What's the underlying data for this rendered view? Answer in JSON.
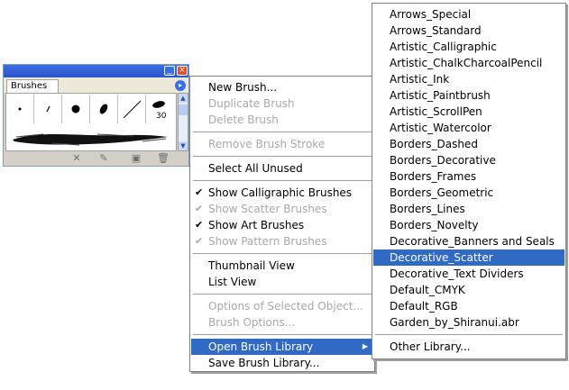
{
  "palette": {
    "tab_label": "Brushes",
    "first_brush_size": "30"
  },
  "menu": {
    "items": [
      {
        "label": "New Brush...",
        "enabled": true
      },
      {
        "label": "Duplicate Brush",
        "enabled": false
      },
      {
        "label": "Delete Brush",
        "enabled": false
      },
      {
        "label": "Remove Brush Stroke",
        "enabled": false
      },
      {
        "label": "Select All Unused",
        "enabled": true
      },
      {
        "label": "Show Calligraphic Brushes",
        "enabled": true,
        "checked": true
      },
      {
        "label": "Show Scatter Brushes",
        "enabled": false,
        "checked": true
      },
      {
        "label": "Show Art Brushes",
        "enabled": true,
        "checked": true
      },
      {
        "label": "Show Pattern Brushes",
        "enabled": false,
        "checked": true
      },
      {
        "label": "Thumbnail View",
        "enabled": true
      },
      {
        "label": "List View",
        "enabled": true
      },
      {
        "label": "Options of Selected Object...",
        "enabled": false
      },
      {
        "label": "Brush Options...",
        "enabled": false
      },
      {
        "label": "Open Brush Library",
        "enabled": true,
        "selected": true
      },
      {
        "label": "Save Brush Library...",
        "enabled": true
      }
    ]
  },
  "submenu": {
    "items": [
      "Arrows_Special",
      "Arrows_Standard",
      "Artistic_Calligraphic",
      "Artistic_ChalkCharcoalPencil",
      "Artistic_Ink",
      "Artistic_Paintbrush",
      "Artistic_ScrollPen",
      "Artistic_Watercolor",
      "Borders_Dashed",
      "Borders_Decorative",
      "Borders_Frames",
      "Borders_Geometric",
      "Borders_Lines",
      "Borders_Novelty",
      "Decorative_Banners and Seals",
      "Decorative_Scatter",
      "Decorative_Text Dividers",
      "Default_CMYK",
      "Default_RGB",
      "Garden_by_Shiranui.abr",
      "Other Library..."
    ],
    "selected_index": 15
  }
}
